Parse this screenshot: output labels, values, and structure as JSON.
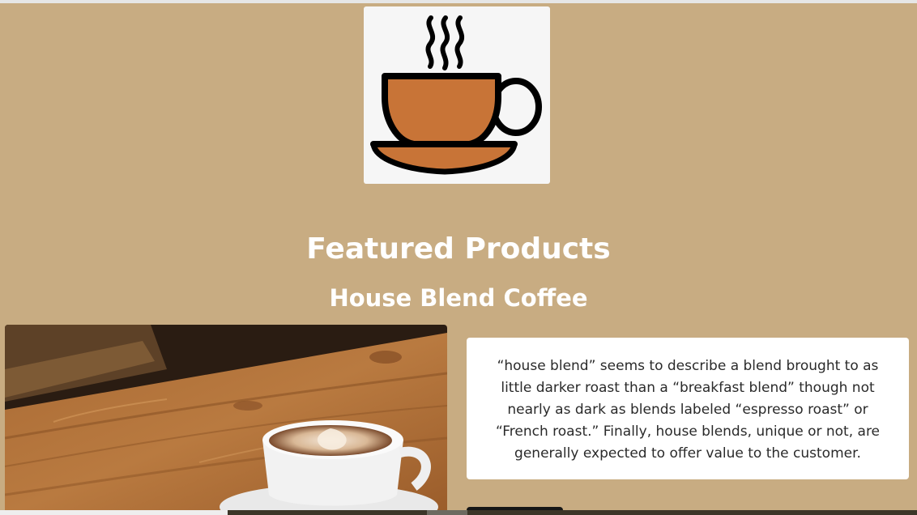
{
  "header": {
    "logo_icon": "coffee-cup-icon"
  },
  "main": {
    "title": "Featured Products",
    "product_name": "House Blend Coffee",
    "product_image_icon": "latte-on-wooden-table-photo",
    "description": "“house blend” seems to describe a blend brought to as little darker roast than a “breakfast blend” though not nearly as dark as blends labeled “espresso roast” or “French roast.” Finally, house blends, unique or not, are generally expected to offer value to the customer."
  },
  "colors": {
    "background": "#c8ac82",
    "card": "#ffffff",
    "cup_fill": "#c87437",
    "button": "#161616"
  }
}
